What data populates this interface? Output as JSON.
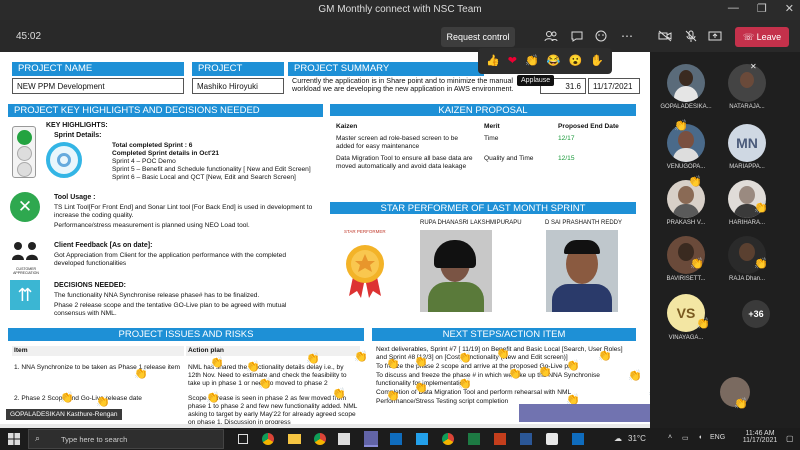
{
  "window": {
    "title": "GM Monthly connect with NSC Team",
    "min": "—",
    "max": "❐",
    "close": "✕"
  },
  "toolbar": {
    "timer": "45:02",
    "request_control": "Request control",
    "leave": "Leave",
    "icons": [
      "people-icon",
      "chat-icon",
      "reactions-icon",
      "more-icon",
      "camera-off-icon",
      "mic-off-icon",
      "share-icon"
    ]
  },
  "reactions": {
    "items": [
      "👍",
      "❤",
      "👏",
      "😂",
      "😮",
      "✋"
    ],
    "tooltip": "Applause"
  },
  "slide": {
    "project_name_label": "PROJECT NAME",
    "project_name_value": "NEW PPM Development",
    "project_manager_label": "PROJECT MANAGER",
    "project_manager_value": "Mashiko Hiroyuki",
    "project_summary_label": "PROJECT SUMMARY",
    "project_summary_text": "Currently the application is in Share point and to minimize the manual workload we are developing the new application in AWS environment.",
    "version_value": "31.6",
    "date_value": "11/17/2021",
    "highlights_title": "PROJECT KEY HIGHLIGHTS AND DECISIONS NEEDED",
    "key_highlights_label": "KEY HIGHLIGHTS:",
    "sprint_details_label": "Sprint Details:",
    "sprint_lines": [
      "Total completed Sprint : 6",
      "Completed Sprint details in Oct'21",
      "Sprint 4 – POC Demo",
      "Sprint 5 – Benefit and Schedule functionality [ New and Edit Screen]",
      "Sprint 6 – Basic Local and QCT [New, Edit and Search Screen]"
    ],
    "tool_usage_label": "Tool Usage :",
    "tool_lines": [
      "TS Lint Tool[For Front End] and Sonar Lint tool [For Back End] is used in development to increase the coding quality.",
      "Performance/stress measurement is planned using NEO Load tool."
    ],
    "client_feedback_label": "Client Feedback [As on date]:",
    "client_feedback_text": "Got Appreciation from Client for the application performance with the completed developed functionalities",
    "customer_appreciation": "CUSTOMER APPRECIATION",
    "decisions_label": "DECISIONS NEEDED:",
    "decision_lines": [
      "The functionality NNA Synchronise release phase# has to be finalized.",
      "Phase 2 release scope and the tentative GO-Live plan to be agreed with mutual consensus with NML."
    ],
    "kaizen_title": "KAIZEN PROPOSAL",
    "kaizen_headers": [
      "Kaizen",
      "Merit",
      "Proposed End Date"
    ],
    "kaizen_rows": [
      [
        "Master screen ad role-based screen to be added for easy maintenance",
        "Time",
        "12/17"
      ],
      [
        "Data Migration Tool to ensure all base data are moved automatically and avoid data leakage",
        "Quality and Time",
        "12/15"
      ]
    ],
    "star_title": "STAR PERFORMER OF LAST MONTH SPRINT",
    "star_badge": "STAR PERFORMER",
    "star_people": [
      "RUPA DHANASRI LAKSHMIPURAPU",
      "D SAI PRASHANTH REDDY"
    ],
    "issues_title": "PROJECT ISSUES AND RISKS",
    "issues_headers": [
      "Item",
      "Action plan"
    ],
    "issues_rows": [
      [
        "1. NNA Synchronize to be taken as Phase 1 release item",
        "NML has shared the functionality details delay i.e., by 12th Nov. Need to estimate and check the feasibility to take up in phase 1 or need to moved to phase 2"
      ],
      [
        "2. Phase 2 Scope and Go-Live release date",
        "Scope increase is seen in phase 2 as few moved from phase 1 to phase 2 and few new functionality added. NML asking to target by early May'22 for already agreed scope on phase 1. Discussion in progress"
      ]
    ],
    "next_title": "NEXT STEPS/ACTION ITEM",
    "next_lines": [
      "Next deliverables, Sprint #7 [ 11/19] on Benefit and  Basic Local [Search, User Roles] and Sprint #8 [12/3] on [Cost Functionality (New and Edit screen)]",
      "To freeze the phase 2 scope and arrive at the proposed Go-Live plan",
      "To discuss and freeze the phase # in which we take up the NNA Synchronise functionality for implementation.",
      "Completion of Data Migration Tool and perform rehearsal with NML",
      "Performance/Stress Testing script completion"
    ]
  },
  "presenter_tag": "GOPALADESIKAN Kasthure-Rengan",
  "participants": [
    {
      "name": "GOPALADESIKA...",
      "initials": "",
      "color": "#5a6b7a"
    },
    {
      "name": "NATARAJA...",
      "initials": "",
      "color": "#444"
    },
    {
      "name": "VENUGOPA...",
      "initials": "",
      "color": "#6a5040"
    },
    {
      "name": "MARIAPPA...",
      "initials": "MN",
      "color": "#cfd8e3"
    },
    {
      "name": "PRAKASH V...",
      "initials": "",
      "color": "#8a6a55"
    },
    {
      "name": "HARIHARA...",
      "initials": "",
      "color": "#9a8a80"
    },
    {
      "name": "BAVIRISETT...",
      "initials": "",
      "color": "#6a4a3a"
    },
    {
      "name": "RAJA Dhan...",
      "initials": "",
      "color": "#2a2a2a"
    },
    {
      "name": "VINAYAGA...",
      "initials": "VS",
      "color": "#f3e6a3"
    },
    {
      "name": "",
      "initials": "+36",
      "color": "#3a3a3a"
    }
  ],
  "taskbar": {
    "search_placeholder": "Type here to search",
    "weather": "31°C",
    "lang": "ENG",
    "time": "11:46 AM",
    "date": "11/17/2021"
  },
  "colors": {
    "accent": "#1e90d6",
    "leave": "#c4314b",
    "teams_purple": "#6264a7"
  }
}
